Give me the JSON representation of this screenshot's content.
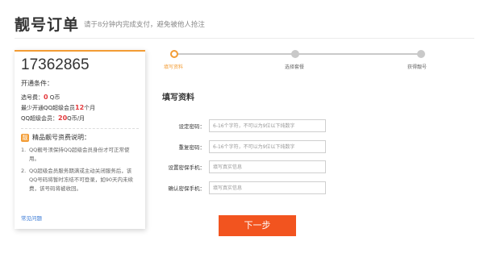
{
  "header": {
    "title": "靓号订单",
    "subtitle": "请于8分钟内完成支付，避免被他人抢注"
  },
  "left_card": {
    "number": "17362865",
    "conditions_title": "开通条件：",
    "conditions": [
      {
        "prefix": "选号费：",
        "highlight": "0",
        "suffix": " Q币"
      },
      {
        "prefix": "最少开通QQ超级会员",
        "highlight": "12",
        "suffix": "个月"
      },
      {
        "prefix": "QQ超级会员：",
        "highlight": "20",
        "suffix": "Q币/月"
      }
    ],
    "info_title": "精品靓号资费说明：",
    "info_icon": "info-badge-icon",
    "notes": [
      {
        "index": "1.",
        "text": "QQ靓号须保持QQ超级会员身份才可正常使用。"
      },
      {
        "index": "2.",
        "text": "QQ超级会员服务期满或主动关闭服务后，该QQ号码将暂时冻结不可登录，如90天内未续费，该号码将被收回。"
      }
    ],
    "faq_link": "常见问题"
  },
  "steps": [
    {
      "label": "填写资料",
      "active": true
    },
    {
      "label": "选择套餐",
      "active": false
    },
    {
      "label": "获得靓号",
      "active": false
    }
  ],
  "form": {
    "title": "填写资料",
    "fields": [
      {
        "label": "设定密码：",
        "placeholder": "6-16个字符，不可以为9位以下纯数字"
      },
      {
        "label": "重复密码：",
        "placeholder": "6-16个字符，不可以为9位以下纯数字"
      },
      {
        "label": "设置密保手机：",
        "placeholder": "填写真实信息"
      },
      {
        "label": "确认密保手机：",
        "placeholder": "填写真实信息"
      }
    ],
    "submit_label": "下一步"
  },
  "colors": {
    "accent": "#f39c34",
    "button": "#f2541f",
    "highlight": "#e4393c",
    "link": "#3a7ad6"
  }
}
